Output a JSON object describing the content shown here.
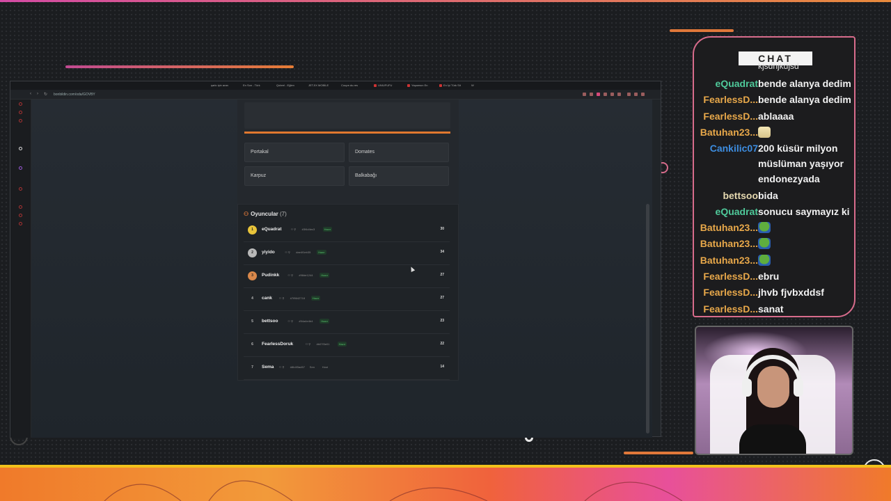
{
  "browser": {
    "tabs": [
      "şarkı için aran",
      "En Son - Türk",
      "Qobrel - Eğlen",
      "JETJIX MOBİLE",
      "Coupe.du.res",
      "UNIUFUFU",
      "Yaşamsın En",
      "En İyi Türk Sit",
      "W"
    ],
    "url": "bonbildin.com/oda/GOVBY"
  },
  "game": {
    "options": [
      "Portakal",
      "Domates",
      "Karpuz",
      "Balkabağı"
    ],
    "players_title": "Oyuncular",
    "players_count": "(7)",
    "ready_label": "Hazır",
    "host_label": "Host",
    "players": [
      {
        "rank": "1",
        "name": "eQuadrat",
        "code": "#3f4d4ec3",
        "score": "30",
        "badge": "gold",
        "ready": true
      },
      {
        "rank": "2",
        "name": "yiyido",
        "code": "#ae4f1eb35",
        "score": "34",
        "badge": "silver",
        "ready": true
      },
      {
        "rank": "3",
        "name": "Pudinkk",
        "code": "#98de1244",
        "score": "27",
        "badge": "bronze",
        "ready": true
      },
      {
        "rank": "4",
        "name": "cank",
        "code": "#7f8642718",
        "score": "27",
        "badge": "none",
        "ready": true
      },
      {
        "rank": "5",
        "name": "bettsoo",
        "code": "#54a4e4b4",
        "score": "23",
        "badge": "none",
        "ready": true
      },
      {
        "rank": "6",
        "name": "FearlessDoruk",
        "code": "#b07f3e01",
        "score": "22",
        "badge": "none",
        "ready": true
      },
      {
        "rank": "7",
        "name": "Sema",
        "code": "#8b4f3ad57",
        "score": "14",
        "badge": "none",
        "ready": false,
        "extra": "Sen",
        "host": true
      }
    ]
  },
  "chat": {
    "header": "CHAT",
    "cutoff_text": "kjsdnjkdjsd",
    "messages": [
      {
        "user": "eQuadrat",
        "text": "bende alanya dedim",
        "color": "#4fc99a"
      },
      {
        "user": "FearlessD...",
        "text": "bende alanya dedim",
        "color": "#e8a84a"
      },
      {
        "user": "FearlessD...",
        "text": "ablaaaa",
        "color": "#e8a84a"
      },
      {
        "user": "Batuhan23...",
        "text": "",
        "emote": "blonde",
        "color": "#e8a84a"
      },
      {
        "user": "Cankilic07",
        "text": "200 küsür milyon müslüman yaşıyor endonezyada",
        "color": "#3d8de0"
      },
      {
        "user": "bettsoo",
        "text": "bida",
        "color": "#e6d9b0"
      },
      {
        "user": "eQuadrat",
        "text": "sonucu saymayız ki",
        "color": "#4fc99a"
      },
      {
        "user": "Batuhan23...",
        "text": "",
        "emote": "pepe",
        "color": "#e8a84a"
      },
      {
        "user": "Batuhan23...",
        "text": "",
        "emote": "pepe",
        "color": "#e8a84a"
      },
      {
        "user": "Batuhan23...",
        "text": "",
        "emote": "pepe",
        "color": "#e8a84a"
      },
      {
        "user": "FearlessD...",
        "text": "ebru",
        "color": "#e8a84a"
      },
      {
        "user": "FearlessD...",
        "text": "jhvb fjvbxddsf",
        "color": "#e8a84a"
      },
      {
        "user": "FearlessD...",
        "text": "sanat",
        "color": "#e8a84a"
      }
    ]
  },
  "colors": {
    "accent_orange": "#e0782f",
    "accent_pink": "#d86c8c",
    "ready_green": "#56c26b"
  }
}
